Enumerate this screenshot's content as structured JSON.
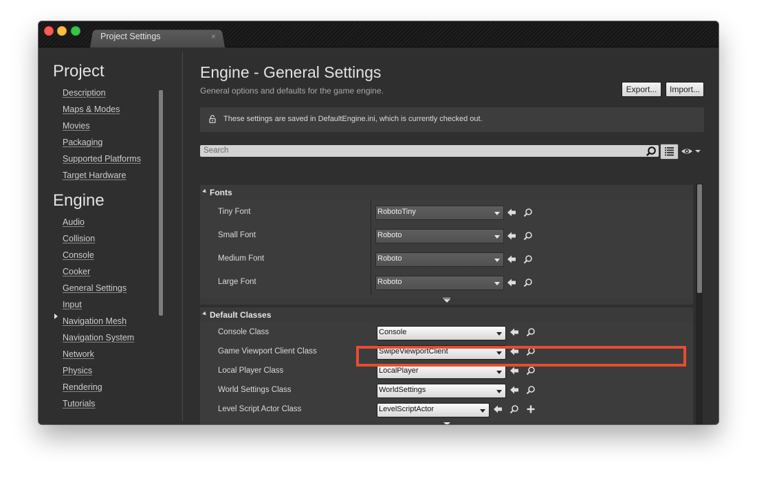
{
  "window": {
    "tab_title": "Project Settings",
    "tab_close": "×"
  },
  "sidebar": {
    "project_title": "Project",
    "project_items": [
      {
        "label": "Description"
      },
      {
        "label": "Maps & Modes"
      },
      {
        "label": "Movies"
      },
      {
        "label": "Packaging"
      },
      {
        "label": "Supported Platforms"
      },
      {
        "label": "Target Hardware"
      }
    ],
    "engine_title": "Engine",
    "engine_items": [
      {
        "label": "Audio"
      },
      {
        "label": "Collision"
      },
      {
        "label": "Console"
      },
      {
        "label": "Cooker"
      },
      {
        "label": "General Settings",
        "selected": true
      },
      {
        "label": "Input"
      },
      {
        "label": "Navigation Mesh"
      },
      {
        "label": "Navigation System"
      },
      {
        "label": "Network"
      },
      {
        "label": "Physics"
      },
      {
        "label": "Rendering"
      },
      {
        "label": "Tutorials"
      }
    ]
  },
  "main": {
    "title": "Engine - General Settings",
    "subtitle": "General options and defaults for the game engine.",
    "export_label": "Export...",
    "import_label": "Import...",
    "notice": "These settings are saved in DefaultEngine.ini, which is currently checked out.",
    "search_placeholder": "Search"
  },
  "fonts_section": {
    "title": "Fonts",
    "rows": [
      {
        "label": "Tiny Font",
        "value": "RobotoTiny"
      },
      {
        "label": "Small Font",
        "value": "Roboto"
      },
      {
        "label": "Medium Font",
        "value": "Roboto"
      },
      {
        "label": "Large Font",
        "value": "Roboto"
      }
    ]
  },
  "classes_section": {
    "title": "Default Classes",
    "rows": [
      {
        "label": "Console Class",
        "value": "Console"
      },
      {
        "label": "Game Viewport Client Class",
        "value": "SwipeViewportClient",
        "highlighted": true
      },
      {
        "label": "Local Player Class",
        "value": "LocalPlayer"
      },
      {
        "label": "World Settings Class",
        "value": "WorldSettings"
      },
      {
        "label": "Level Script Actor Class",
        "value": "LevelScriptActor"
      }
    ]
  },
  "colors": {
    "highlight": "#e84c2e",
    "panel_bg": "#2f2f2f",
    "row_bg": "#3c3c3c"
  }
}
